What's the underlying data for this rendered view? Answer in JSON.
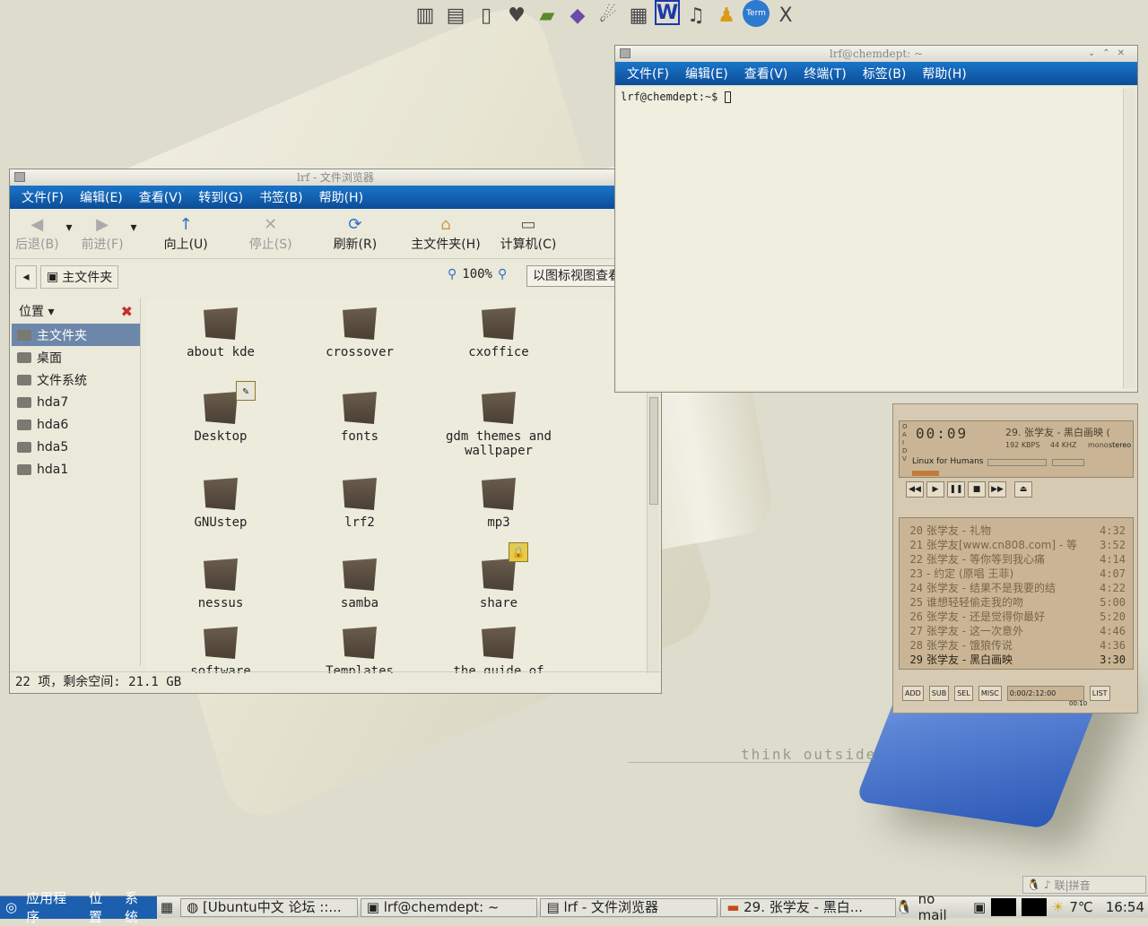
{
  "wallpaper": {
    "slogan": "think outside"
  },
  "launcher": {
    "icons": [
      "library-icon",
      "notes-icon",
      "scroll-icon",
      "pet-icon",
      "books-icon",
      "education-icon",
      "gimp-icon",
      "film-icon",
      "word-icon",
      "music-icon",
      "figure-icon",
      "term-icon",
      "x-icon"
    ],
    "term_label": "Term",
    "word_label": "W",
    "x_label": "X"
  },
  "file_manager": {
    "title": "lrf - 文件浏览器",
    "menu": [
      "文件(F)",
      "编辑(E)",
      "查看(V)",
      "转到(G)",
      "书签(B)",
      "帮助(H)"
    ],
    "toolbar": {
      "back": "后退(B)",
      "forward": "前进(F)",
      "up": "向上(U)",
      "stop": "停止(S)",
      "reload": "刷新(R)",
      "home": "主文件夹(H)",
      "computer": "计算机(C)"
    },
    "location": "主文件夹",
    "zoom": "100%",
    "view_mode": "以图标视图查看",
    "sidebar": {
      "title": "位置",
      "items": [
        "主文件夹",
        "桌面",
        "文件系统",
        "hda7",
        "hda6",
        "hda5",
        "hda1"
      ]
    },
    "files": [
      "about kde",
      "crossover",
      "cxoffice",
      "Desktop",
      "fonts",
      "gdm themes and wallpaper",
      "GNUstep",
      "lrf2",
      "mp3",
      "nessus",
      "samba",
      "share",
      "software",
      "Templates",
      "the guide of"
    ],
    "status": "22 项，剩余空间: 21.1 GB"
  },
  "terminal": {
    "title": "lrf@chemdept: ~",
    "menu": [
      "文件(F)",
      "编辑(E)",
      "查看(V)",
      "终端(T)",
      "标签(B)",
      "帮助(H)"
    ],
    "prompt": "lrf@chemdept:~$"
  },
  "xmms": {
    "time": "00:09",
    "title": "29. 张学友 - 黑白画映 (",
    "bitrate": "192 KBPS",
    "khz": "44 KHZ",
    "mono": "mono",
    "stereo": "stereo",
    "skin": "Linux for Humans",
    "sidebar_text": "OAIDV",
    "playlist": [
      {
        "n": "20",
        "t": "张学友 - 礼物",
        "d": "4:32"
      },
      {
        "n": "21",
        "t": "张学友[www.cn808.com] - 等",
        "d": "3:52"
      },
      {
        "n": "22",
        "t": "张学友 - 等你等到我心痛",
        "d": "4:14"
      },
      {
        "n": "23",
        "t": "- 约定 (原唱 王菲)",
        "d": "4:07"
      },
      {
        "n": "24",
        "t": "张学友 - 结果不是我要的结",
        "d": "4:22"
      },
      {
        "n": "25",
        "t": "谁想轻轻偷走我的吻",
        "d": "5:00"
      },
      {
        "n": "26",
        "t": "张学友 - 还是觉得你最好",
        "d": "5:20"
      },
      {
        "n": "27",
        "t": "张学友 - 这一次意外",
        "d": "4:46"
      },
      {
        "n": "28",
        "t": "张学友 - 饿狼传说",
        "d": "4:36"
      },
      {
        "n": "29",
        "t": "张学友 - 黑白画映",
        "d": "3:30"
      }
    ],
    "playlist_buttons": [
      "ADD",
      "SUB",
      "SEL",
      "MISC",
      "LIST"
    ],
    "playlist_time": "0:00/2:12:00",
    "mini_time": "00:10"
  },
  "input_method": {
    "label": "联|拼音"
  },
  "taskbar": {
    "menus": [
      "应用程序",
      "位置",
      "系统"
    ],
    "tasks": [
      "[Ubuntu中文 论坛 ::...",
      "lrf@chemdept: ~",
      "lrf - 文件浏览器",
      "29. 张学友 - 黑白..."
    ],
    "mail": "no mail",
    "temp": "7℃",
    "clock": "16:54"
  }
}
